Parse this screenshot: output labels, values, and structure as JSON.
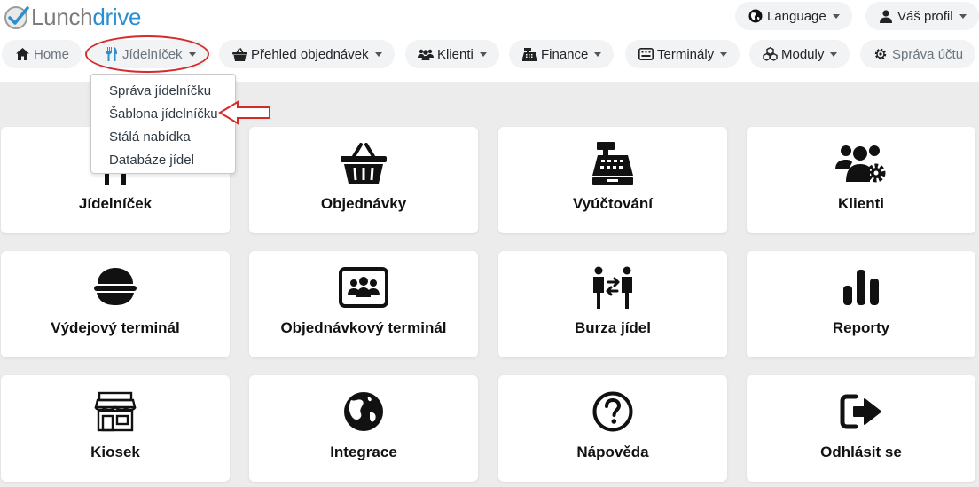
{
  "logo": {
    "part1": "Lunch",
    "part2": "drive"
  },
  "header": {
    "language_label": "Language",
    "profile_label": "Váš profil"
  },
  "nav": {
    "home": "Home",
    "jidelnicek": "Jídelníček",
    "prehled": "Přehled objednávek",
    "klienti": "Klienti",
    "finance": "Finance",
    "terminaly": "Terminály",
    "moduly": "Moduly",
    "sprava_uctu": "Správa účtu"
  },
  "dropdown": {
    "items": [
      "Správa jídelníčku",
      "Šablona jídelníčku",
      "Stálá nabídka",
      "Databáze jídel"
    ]
  },
  "tiles": {
    "jidelnicek": "Jídelníček",
    "objednavky": "Objednávky",
    "vyuctovani": "Vyúčtování",
    "klienti": "Klienti",
    "vydejovy": "Výdejový terminál",
    "objednavkovy": "Objednávkový terminál",
    "burza": "Burza jídel",
    "reporty": "Reporty",
    "kiosek": "Kiosek",
    "integrace": "Integrace",
    "napoveda": "Nápověda",
    "odhlasit": "Odhlásit se"
  },
  "colors": {
    "brand_blue": "#2a8fd0",
    "brand_gray": "#7b7b7b",
    "annotation_red": "#d42b2b"
  }
}
